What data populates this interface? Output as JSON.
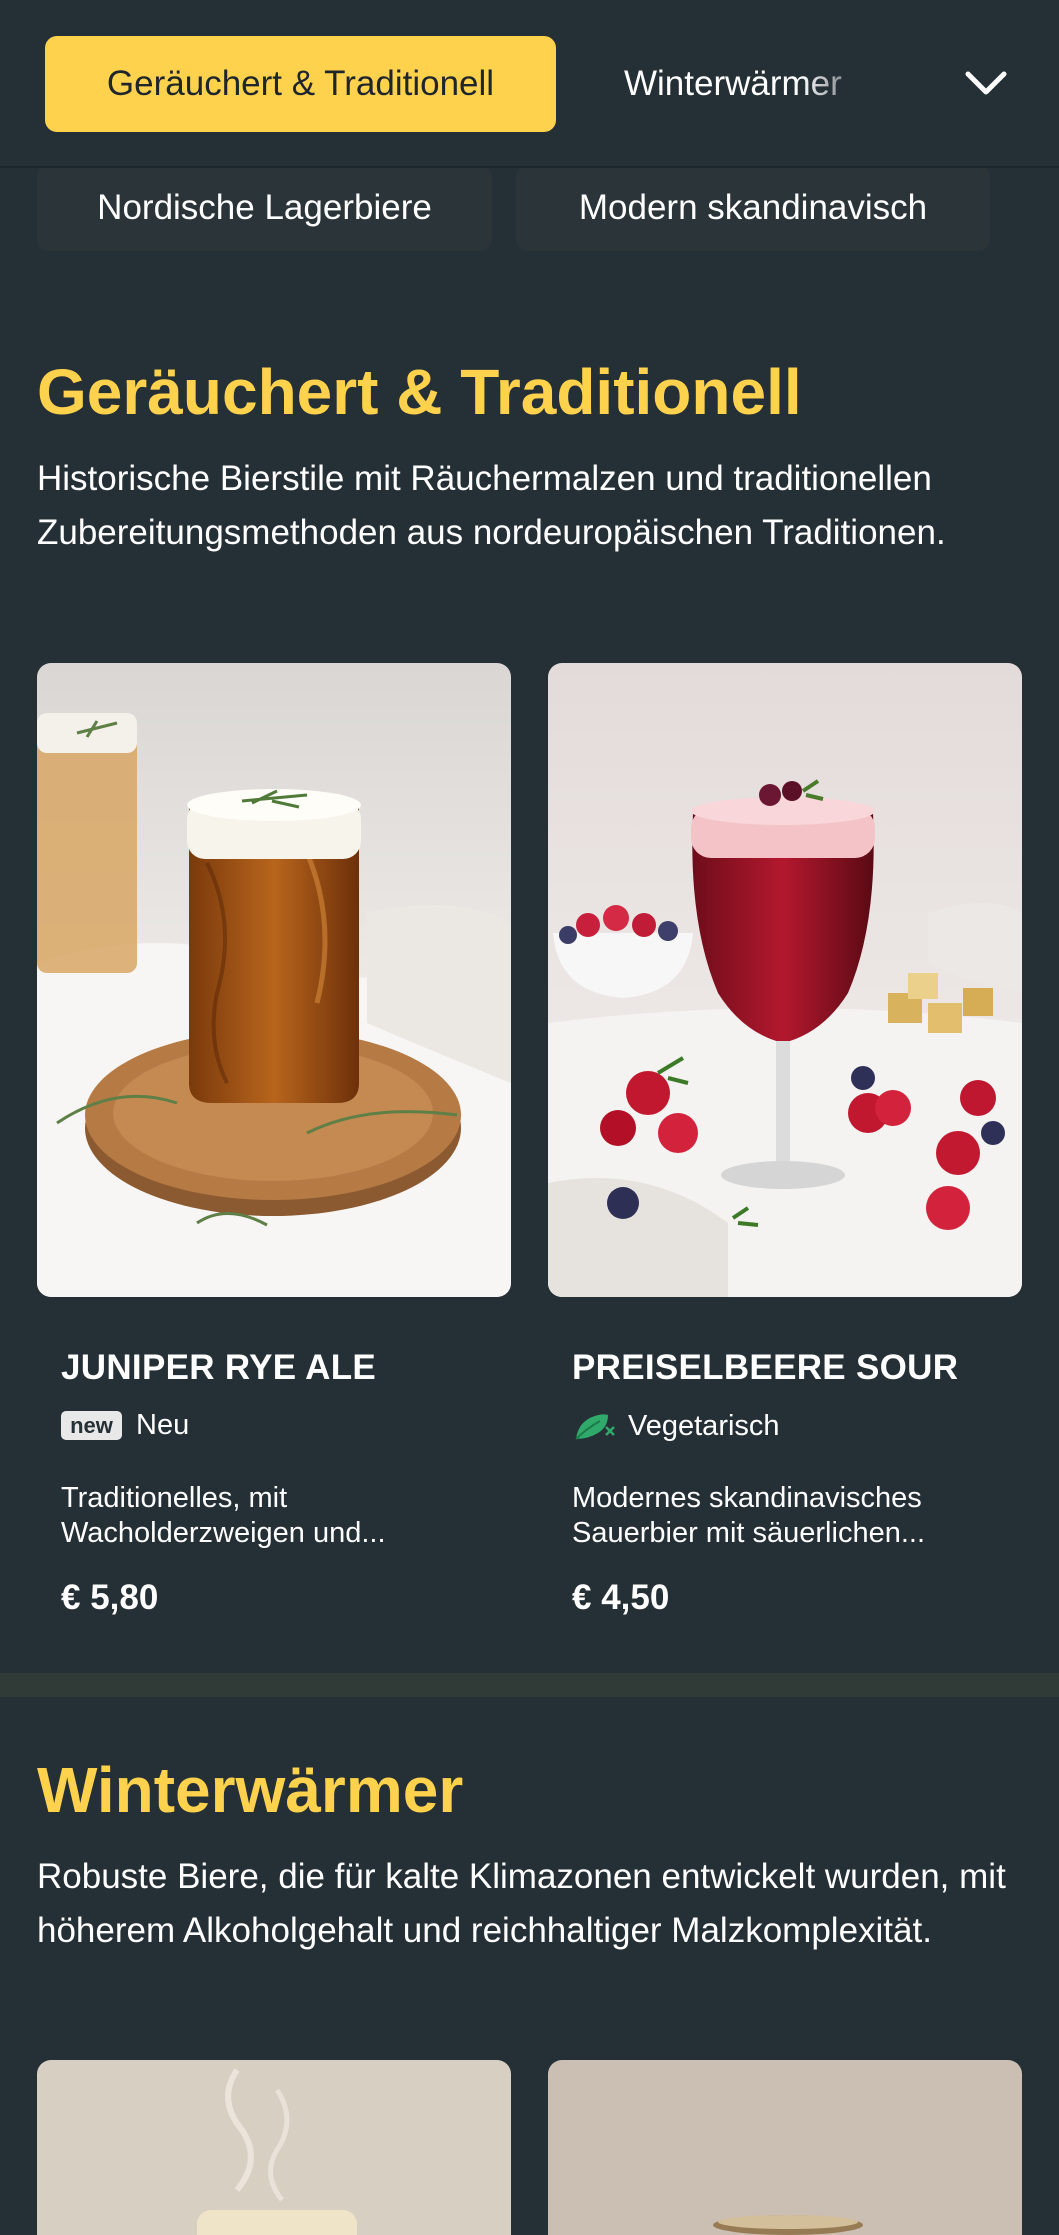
{
  "nav": {
    "active_tab": "Geräuchert & Traditionell",
    "next_tab": "Winterwärmer",
    "chevron_icon": "chevron-down-icon",
    "chips": [
      "Nordische Lagerbiere",
      "Modern skandinavisch"
    ]
  },
  "sections": [
    {
      "title": "Geräuchert & Traditionell",
      "description": "Historische Bierstile mit Räuchermalzen und traditionellen Zubereitungsmethoden aus nordeuropäischen Traditionen.",
      "items": [
        {
          "name": "JUNIPER RYE ALE",
          "badge": "new",
          "tag": "Neu",
          "description_lines": [
            "Traditionelles, mit",
            "Wacholderzweigen und..."
          ],
          "price": "€ 5,80"
        },
        {
          "name": "PREISELBEERE SOUR",
          "tag_icon": "vegetarian-leaf-icon",
          "tag": "Vegetarisch",
          "description_lines": [
            "Modernes skandinavisches",
            "Sauerbier mit säuerlichen..."
          ],
          "price": "€ 4,50"
        }
      ]
    },
    {
      "title": "Winterwärmer",
      "description": "Robuste Biere, die für kalte Klimazonen entwickelt wurden, mit höherem Alkoholgehalt und reichhaltiger Malzkomplexität."
    }
  ],
  "colors": {
    "background": "#252f36",
    "accent": "#fed24c",
    "chip": "#2b3439",
    "vegetarian_green": "#2faa6a"
  }
}
